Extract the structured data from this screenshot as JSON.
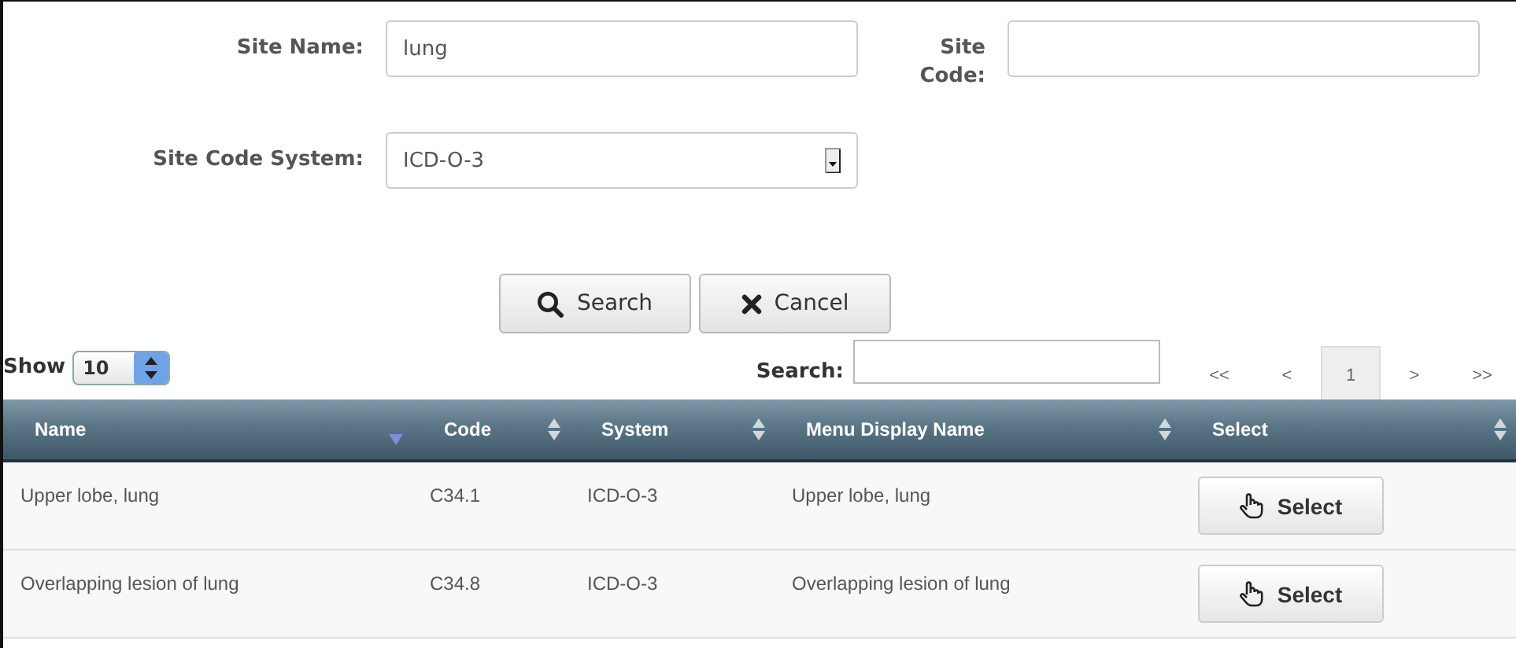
{
  "form": {
    "site_name": {
      "label": "Site Name:",
      "value": "lung"
    },
    "site_code": {
      "label_lines": [
        "Site",
        "Code:"
      ]
    },
    "site_code_system": {
      "label": "Site Code System:",
      "value": "ICD-O-3"
    }
  },
  "buttons": [
    {
      "kind": "search",
      "label": "Search"
    },
    {
      "kind": "cancel",
      "label": "Cancel"
    }
  ],
  "show": {
    "label": "Show",
    "value": "10"
  },
  "table_search": {
    "label": "Search:"
  },
  "pagination": [
    {
      "label": "<<",
      "selected": false
    },
    {
      "label": "<",
      "selected": false
    },
    {
      "label": "1",
      "selected": true
    },
    {
      "label": ">",
      "selected": false
    },
    {
      "label": ">>",
      "selected": false
    }
  ],
  "table": {
    "columns": [
      {
        "label": "Name",
        "sorted": true
      },
      {
        "label": "Code",
        "sorted": false
      },
      {
        "label": "System",
        "sorted": false
      },
      {
        "label": "Menu Display Name",
        "sorted": false
      },
      {
        "label": "Select",
        "sorted": false
      }
    ],
    "rows": [
      {
        "name": "Upper lobe, lung",
        "code": "C34.1",
        "system": "ICD-O-3",
        "menu_display_name": "Upper lobe, lung",
        "action": "Select"
      },
      {
        "name": "Overlapping lesion of lung",
        "code": "C34.8",
        "system": "ICD-O-3",
        "menu_display_name": "Overlapping lesion of lung",
        "action": "Select"
      }
    ]
  }
}
